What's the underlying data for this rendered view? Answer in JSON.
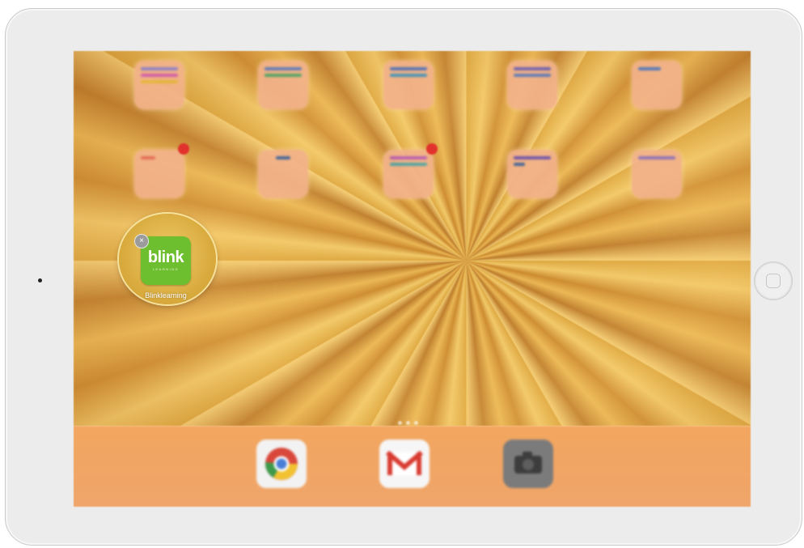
{
  "home_screen": {
    "focused_app": {
      "logo_text": "blink",
      "logo_subtext": "LEARNING",
      "label": "Blinklearning",
      "delete_glyph": "×",
      "icon_color": "#6ebf2f"
    },
    "icons": {
      "delete": "close-icon",
      "home_button": "home-button-icon",
      "chrome": "chrome-icon",
      "gmail": "gmail-icon",
      "camera": "camera-icon"
    },
    "colors": {
      "wallpaper_gold": "#d9a23a",
      "dock": "#f2a65f",
      "badge_red": "#e2322d",
      "device_frame": "#ececec"
    }
  }
}
